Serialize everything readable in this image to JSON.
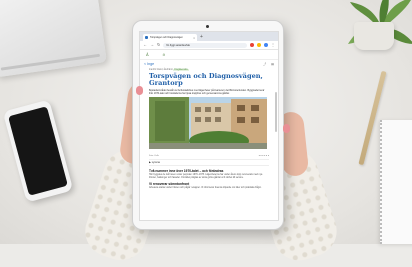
{
  "browser": {
    "tab_title": "Torspvägen och Diagnosvägen",
    "tab_close": "×",
    "new_tab": "+",
    "url": "ftn.figgt.se/ardeo/tak",
    "ext_colors": [
      "#e94235",
      "#fbbc04",
      "#34a853",
      "#4285f4"
    ]
  },
  "site": {
    "nav": [
      "Å",
      "ð"
    ],
    "back_label": "< Inge"
  },
  "article": {
    "meta_prefix": "Inanför bland, återhämt",
    "meta_tag": "Flogistenstra",
    "title": "Torspvägen och Diagnosvägen, Grantorp",
    "lead": "Bostadsområdet består av flerbostadshus med lägenheter på kvarteret i det Blomsterlunden. Byggnaderna är från 1970-talet och bostäderna har ljusa trapphus och gemensamma gårdar.",
    "caption_left": "Foto: Kalle",
    "caption_right": "● ● ● ● ● ●",
    "listen_label": "▶ Lyssna",
    "section1_title": "Två nummer inne över 1970-talet – och förändras",
    "section1_body": "Här byggdes de två husen under perioden 1970–1975. Lägenheterna har under årens lopp renoverats med nya fönster, balkonger och fasader. Området präglas av stora gröna gårdar och närhet till service.",
    "section2_title": "Vi renoverar sömntonfront",
    "section2_body": "Arbetena startar under hösten och pågår i etapper. Vi informerar boende löpande om tider och praktiska frågor."
  }
}
